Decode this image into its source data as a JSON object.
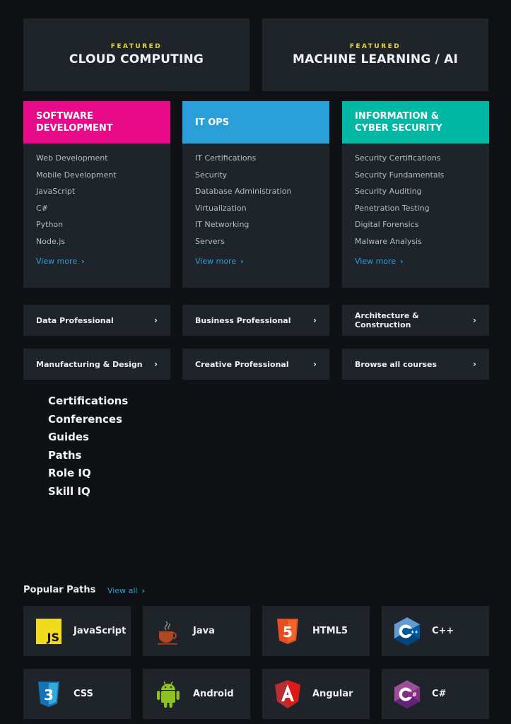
{
  "featured": [
    {
      "kicker": "FEATURED",
      "title": "CLOUD COMPUTING"
    },
    {
      "kicker": "FEATURED",
      "title": "MACHINE LEARNING / AI"
    }
  ],
  "categories": [
    {
      "title": "SOFTWARE\nDEVELOPMENT",
      "color": "#e80a89",
      "items": [
        "Web Development",
        "Mobile Development",
        "JavaScript",
        "C#",
        "Python",
        "Node.js"
      ],
      "view_more": "View more"
    },
    {
      "title": "IT OPS",
      "color": "#2a9fd8",
      "items": [
        "IT Certifications",
        "Security",
        "Database Administration",
        "Virtualization",
        "IT Networking",
        "Servers"
      ],
      "view_more": "View more"
    },
    {
      "title": "INFORMATION &\nCYBER SECURITY",
      "color": "#00b8a3",
      "items": [
        "Security Certifications",
        "Security Fundamentals",
        "Security Auditing",
        "Penetration Testing",
        "Digital Forensics",
        "Malware Analysis"
      ],
      "view_more": "View more"
    }
  ],
  "tiles": [
    {
      "label": "Data Professional"
    },
    {
      "label": "Business Professional"
    },
    {
      "label": "Architecture & Construction"
    },
    {
      "label": "Manufacturing & Design"
    },
    {
      "label": "Creative Professional"
    },
    {
      "label": "Browse all courses"
    }
  ],
  "chevron": "›",
  "links": [
    "Certifications",
    "Conferences",
    "Guides",
    "Paths",
    "Role IQ",
    "Skill IQ"
  ],
  "popular_paths": {
    "title": "Popular Paths",
    "view_all": "View all",
    "items": [
      {
        "label": "JavaScript",
        "icon": "javascript-logo-icon"
      },
      {
        "label": "Java",
        "icon": "java-logo-icon"
      },
      {
        "label": "HTML5",
        "icon": "html5-logo-icon"
      },
      {
        "label": "C++",
        "icon": "cpp-logo-icon"
      },
      {
        "label": "CSS",
        "icon": "css3-logo-icon"
      },
      {
        "label": "Android",
        "icon": "android-logo-icon"
      },
      {
        "label": "Angular",
        "icon": "angular-logo-icon"
      },
      {
        "label": "C#",
        "icon": "csharp-logo-icon"
      }
    ]
  }
}
